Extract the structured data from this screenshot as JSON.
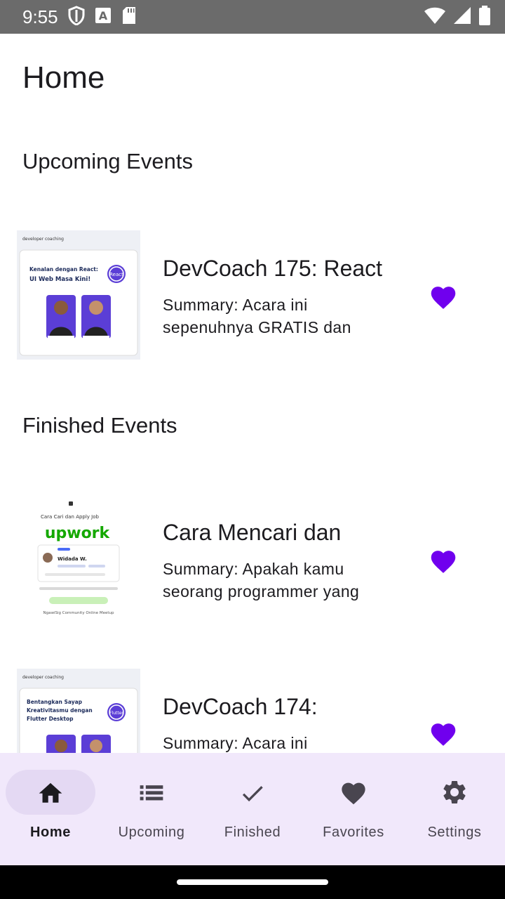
{
  "status_bar": {
    "time": "9:55",
    "icons": [
      "shield-icon",
      "a-notification-icon",
      "sd-card-icon",
      "wifi-icon",
      "cell-signal-icon",
      "battery-icon"
    ]
  },
  "header": {
    "title": "Home"
  },
  "sections": {
    "upcoming": {
      "title": "Upcoming Events",
      "events": [
        {
          "name": "DevCoach 175: React",
          "summary": "Summary: Acara ini sepenuhnya GRATIS dan",
          "thumb": {
            "brand": "developer coaching",
            "headline": "Kenalan dengan React: UI Web Masa Kini!",
            "badge": "React"
          },
          "favorited": true
        }
      ]
    },
    "finished": {
      "title": "Finished Events",
      "events": [
        {
          "name": "Cara Mencari dan",
          "summary": "Summary: Apakah kamu seorang programmer yang",
          "thumb": {
            "headline": "Cara Cari dan Apply Job",
            "brand": "upwork",
            "presenter": "Widada W.",
            "footer": "NgawiSig Community Online Meetup"
          },
          "favorited": true
        },
        {
          "name": "DevCoach 174:",
          "summary": "Summary: Acara ini",
          "thumb": {
            "brand": "developer coaching",
            "headline": "Bentangkan Sayap Kreativitasmu dengan Flutter Desktop",
            "badge": "Flutter"
          },
          "favorited": true
        }
      ]
    }
  },
  "bottom_nav": {
    "items": [
      {
        "label": "Home",
        "icon": "home-icon",
        "active": true
      },
      {
        "label": "Upcoming",
        "icon": "list-icon",
        "active": false
      },
      {
        "label": "Finished",
        "icon": "check-icon",
        "active": false
      },
      {
        "label": "Favorites",
        "icon": "heart-icon",
        "active": false
      },
      {
        "label": "Settings",
        "icon": "gear-icon",
        "active": false
      }
    ]
  },
  "colors": {
    "accent": "#7000ee",
    "nav_background": "#f1e8fb",
    "nav_active_pill": "#e4d9f3",
    "status_bar": "#6b6b6b"
  }
}
